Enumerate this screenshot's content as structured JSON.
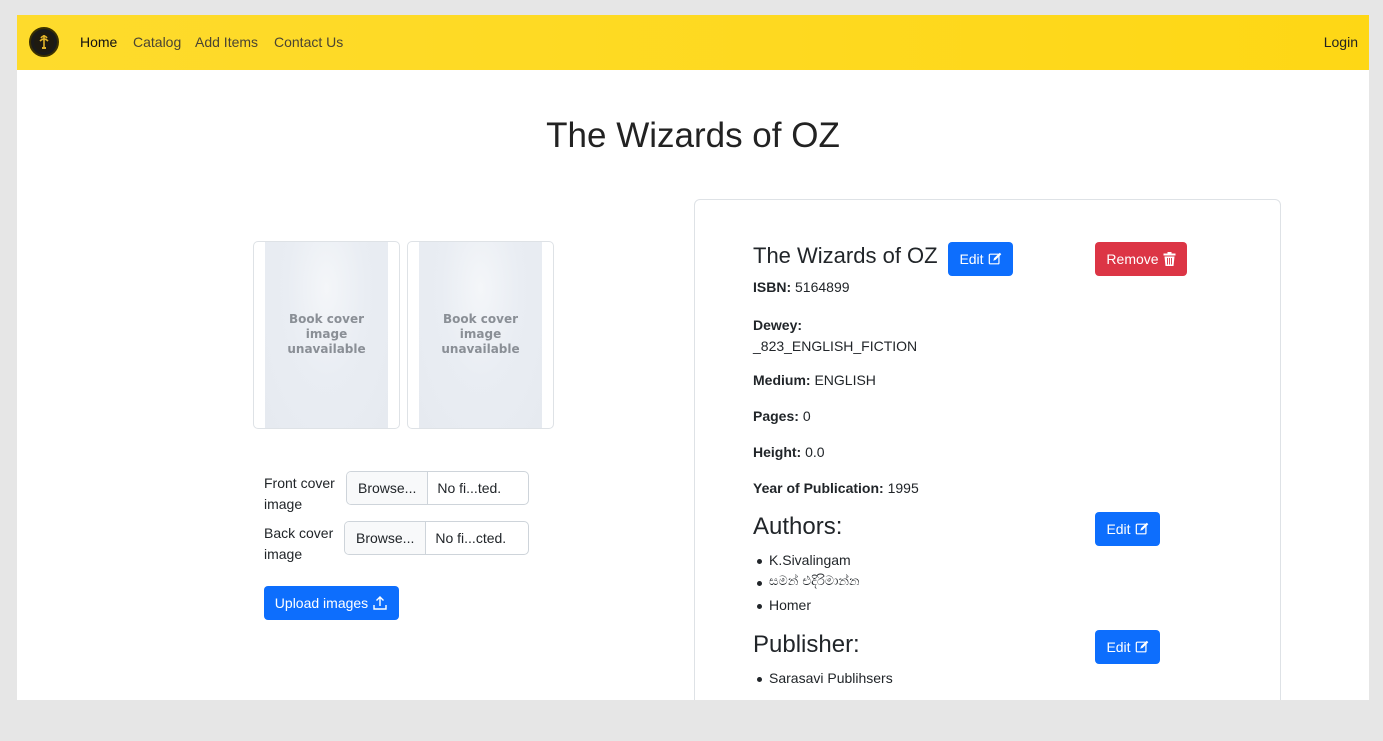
{
  "nav": {
    "links": [
      "Home",
      "Catalog",
      "Add Items",
      "Contact Us"
    ],
    "login": "Login",
    "bg_color": "#fed91f"
  },
  "page": {
    "title": "The Wizards of OZ"
  },
  "covers": {
    "front_placeholder": "Book cover image unavailable",
    "back_placeholder": "Book cover image unavailable",
    "front_label": "Front cover image",
    "back_label": "Back cover image",
    "browse_label": "Browse...",
    "front_file": "No fi...ted.",
    "back_file": "No fi...cted.",
    "upload_label": "Upload images"
  },
  "book": {
    "title": "The Wizards of OZ",
    "edit_label": "Edit",
    "remove_label": "Remove",
    "isbn_label": "ISBN:",
    "isbn": "5164899",
    "dewey_label": "Dewey:",
    "dewey": "_823_ENGLISH_FICTION",
    "medium_label": "Medium:",
    "medium": "ENGLISH",
    "pages_label": "Pages:",
    "pages": "0",
    "height_label": "Height:",
    "height": "0.0",
    "year_label": "Year of Publication:",
    "year": "1995"
  },
  "authors": {
    "heading": "Authors:",
    "edit_label": "Edit",
    "items": [
      "K.Sivalingam",
      "සමන් එදිරිමාන්න",
      "Homer"
    ]
  },
  "publisher": {
    "heading": "Publisher:",
    "edit_label": "Edit",
    "items": [
      "Sarasavi Publihsers"
    ]
  },
  "colors": {
    "primary": "#0d6efd",
    "danger": "#dc3545"
  },
  "icons": {
    "logo": "library-logo-icon",
    "edit": "edit-icon",
    "remove": "trash-icon",
    "upload": "upload-icon"
  }
}
